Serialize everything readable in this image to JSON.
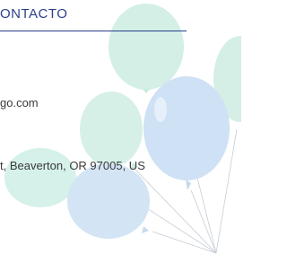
{
  "section": {
    "title": "ONTACTO"
  },
  "contact": {
    "email_fragment": "go.com",
    "address_fragment": "t, Beaverton, OR 97005, US"
  },
  "colors": {
    "title": "#2b3f8a",
    "text": "#3a3a3a",
    "balloon_green": "#d3efe6",
    "balloon_blue": "#cfe1f4",
    "string": "#c6cdd6"
  },
  "decoration": {
    "icon": "balloons-icon"
  }
}
